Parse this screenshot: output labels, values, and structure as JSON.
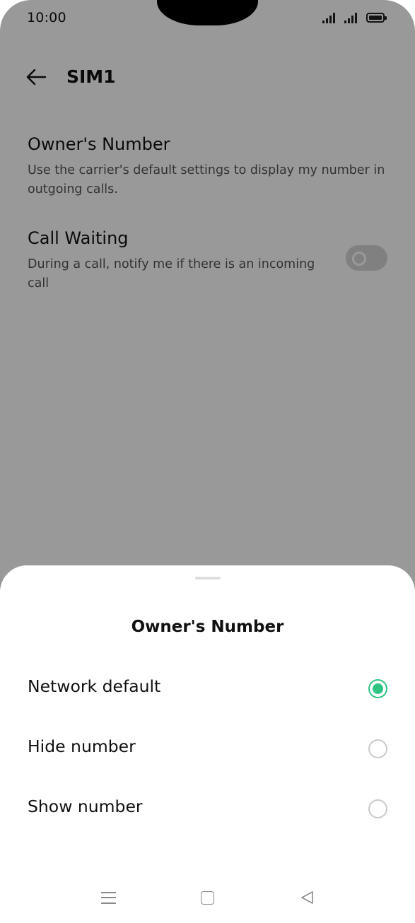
{
  "status_bar": {
    "time": "10:00"
  },
  "header": {
    "title": "SIM1",
    "back_icon": "arrow-left-icon"
  },
  "settings": [
    {
      "title": "Owner's Number",
      "subtitle_lines": [
        "Use the carrier's default settings to display my number in",
        "outgoing calls."
      ]
    },
    {
      "title": "Call Waiting",
      "subtitle_lines": [
        "During a call, notify me if there is an incoming",
        "call"
      ],
      "toggle_on": false
    }
  ],
  "sheet": {
    "title": "Owner's Number",
    "options": [
      {
        "label": "Network default",
        "selected": true
      },
      {
        "label": "Hide number",
        "selected": false
      },
      {
        "label": "Show number",
        "selected": false
      }
    ]
  },
  "colors": {
    "accent": "#2fc482",
    "scrim": "#9e9e9e"
  }
}
